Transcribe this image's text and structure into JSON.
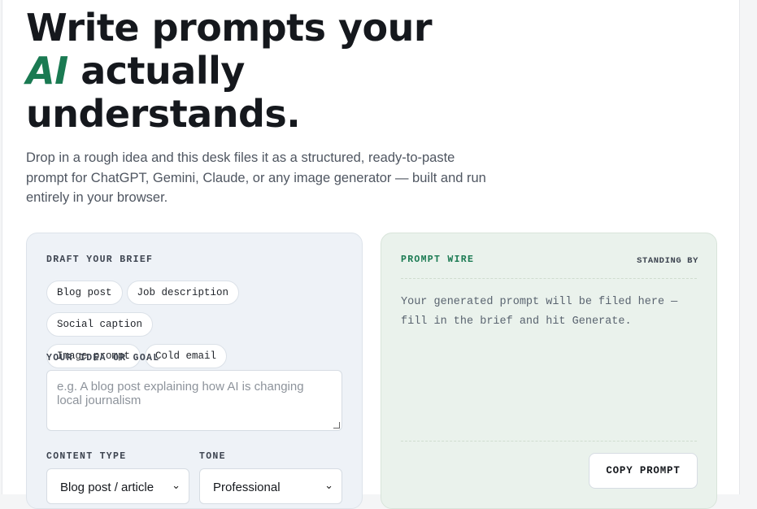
{
  "hero": {
    "title_line1": "Write prompts your",
    "title_accent": "AI",
    "title_line2_rest": " actually",
    "title_line3": "understands.",
    "lead": "Drop in a rough idea and this desk files it as a structured, ready-to-paste prompt for ChatGPT, Gemini, Claude, or any image generator — built and run entirely in your browser."
  },
  "brief": {
    "heading": "DRAFT YOUR BRIEF",
    "chips": [
      "Blog post",
      "Job description",
      "Social caption",
      "Image prompt",
      "Cold email"
    ],
    "idea_label": "YOUR IDEA OR GOAL",
    "idea_placeholder": "e.g. A blog post explaining how AI is changing local journalism",
    "content_type_label": "CONTENT TYPE",
    "content_type_value": "Blog post / article",
    "tone_label": "TONE",
    "tone_value": "Professional"
  },
  "wire": {
    "heading": "PROMPT WIRE",
    "status": "STANDING BY",
    "placeholder": "Your generated prompt will be filed here — fill in the brief and hit Generate.",
    "copy_label": "COPY PROMPT"
  },
  "colors": {
    "accent": "#1a7a52",
    "brief_bg": "#eef2f7",
    "wire_bg": "#eaf2ec"
  },
  "icons": {
    "select_chevron": "chevron-down-icon"
  }
}
